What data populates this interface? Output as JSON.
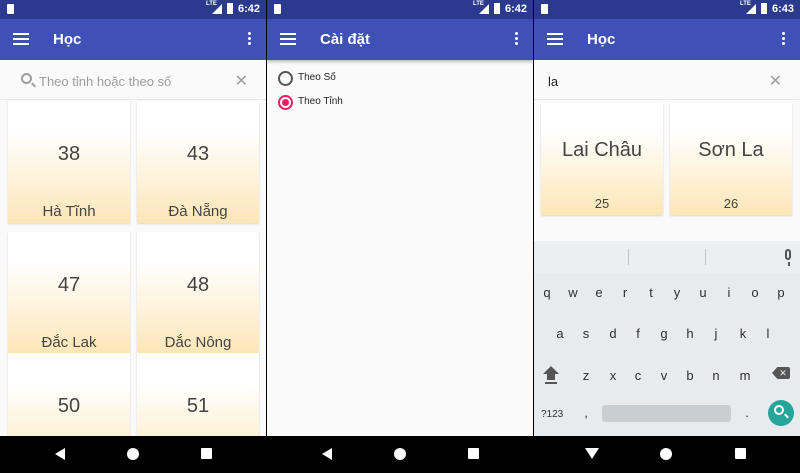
{
  "status": {
    "network": "LTE",
    "time_1": "6:42",
    "time_2": "6:42",
    "time_3": "6:43"
  },
  "screen1": {
    "title": "Học",
    "search_placeholder": "Theo tỉnh hoặc theo số",
    "clear_symbol": "✕",
    "cards": [
      {
        "number": "38",
        "name": "Hà Tĩnh"
      },
      {
        "number": "43",
        "name": "Đà Nẵng"
      },
      {
        "number": "47",
        "name": "Đắc Lak"
      },
      {
        "number": "48",
        "name": "Dắc Nông"
      },
      {
        "number": "50",
        "name": ""
      },
      {
        "number": "51",
        "name": ""
      }
    ]
  },
  "screen2": {
    "title": "Cài đặt",
    "options": [
      {
        "label": "Theo Số",
        "selected": false
      },
      {
        "label": "Theo Tỉnh",
        "selected": true
      }
    ]
  },
  "screen3": {
    "title": "Học",
    "search_value": "la",
    "clear_symbol": "✕",
    "results": [
      {
        "name": "Lai Châu",
        "number": "25"
      },
      {
        "name": "Sơn La",
        "number": "26"
      }
    ],
    "keyboard": {
      "row1": [
        "q",
        "w",
        "e",
        "r",
        "t",
        "y",
        "u",
        "i",
        "o",
        "p"
      ],
      "row2": [
        "a",
        "s",
        "d",
        "f",
        "g",
        "h",
        "j",
        "k",
        "l"
      ],
      "row3": [
        "z",
        "x",
        "c",
        "v",
        "b",
        "n",
        "m"
      ],
      "symbols_key": "?123",
      "comma_key": ",",
      "period_key": "."
    }
  },
  "colors": {
    "statusbar": "#2b3a8f",
    "appbar": "#3f51b5",
    "card_gradient_end": "#fde6b7",
    "radio_selected": "#e91e63",
    "keyboard_enter": "#26a69a"
  },
  "icons": [
    "menu-icon",
    "more-vert-icon",
    "search-icon",
    "close-icon",
    "mic-icon",
    "shift-icon",
    "backspace-icon",
    "enter-search-icon",
    "nav-back-icon",
    "nav-home-icon",
    "nav-recent-icon",
    "nav-hide-keyboard-icon"
  ]
}
